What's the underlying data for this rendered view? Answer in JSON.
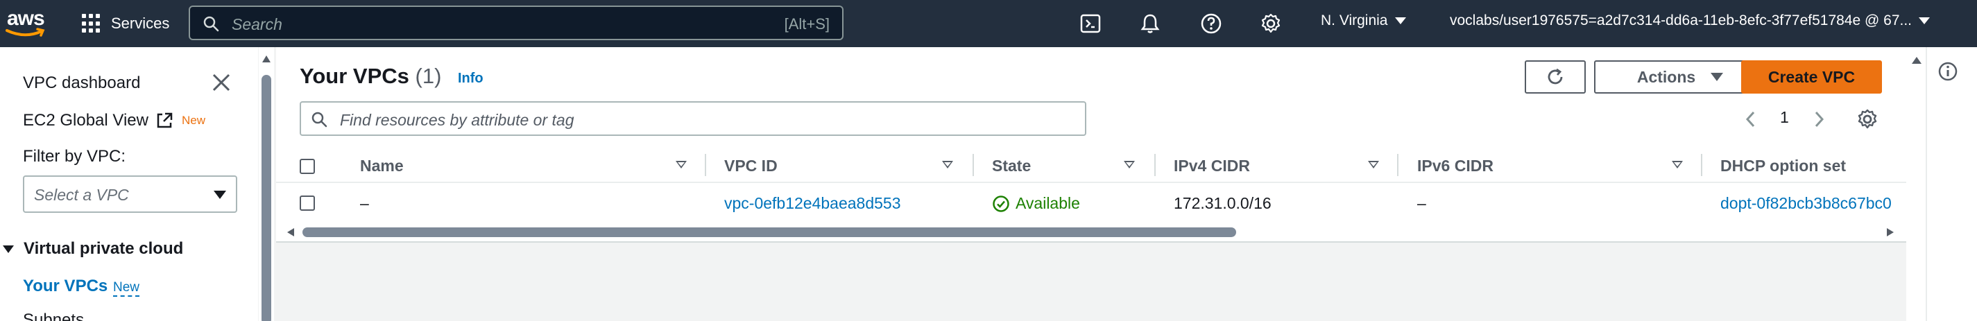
{
  "topnav": {
    "logo_text": "aws",
    "services_label": "Services",
    "search_placeholder": "Search",
    "search_shortcut": "[Alt+S]",
    "region_label": "N. Virginia",
    "account_label": "voclabs/user1976575=a2d7c314-dd6a-11eb-8efc-3f77ef51784e @ 67..."
  },
  "sidebar": {
    "dashboard_label": "VPC dashboard",
    "ec2_global_label": "EC2 Global View",
    "ec2_global_badge": "New",
    "filter_label": "Filter by VPC:",
    "select_placeholder": "Select a VPC",
    "section_title": "Virtual private cloud",
    "active_item_label": "Your VPCs",
    "active_item_badge": "New",
    "next_item_label": "Subnets"
  },
  "main": {
    "title": "Your VPCs",
    "count": "(1)",
    "info_label": "Info",
    "actions_label": "Actions",
    "create_label": "Create VPC",
    "filter_placeholder": "Find resources by attribute or tag",
    "page_number": "1",
    "columns": [
      "Name",
      "VPC ID",
      "State",
      "IPv4 CIDR",
      "IPv6 CIDR",
      "DHCP option set"
    ],
    "rows": [
      {
        "name": "–",
        "vpc_id": "vpc-0efb12e4baea8d553",
        "state": "Available",
        "ipv4": "172.31.0.0/16",
        "ipv6": "–",
        "dhcp": "dopt-0f82bcb3b8c67bc0"
      }
    ]
  },
  "colors": {
    "nav_bg": "#232f3e",
    "link": "#0073bb",
    "primary": "#ec7211",
    "success": "#1d8102",
    "new_badge": "#ec7211"
  }
}
